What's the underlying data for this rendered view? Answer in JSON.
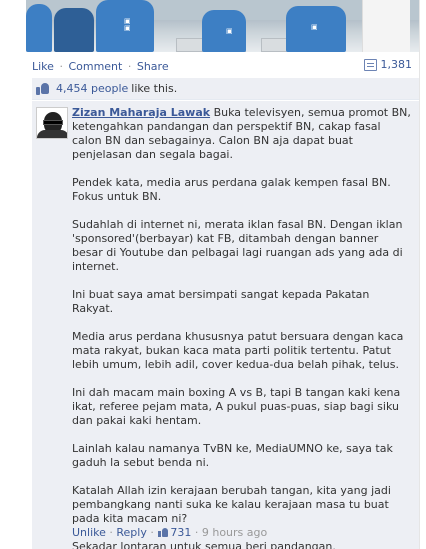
{
  "actions": {
    "like": "Like",
    "comment": "Comment",
    "share": "Share",
    "separator": "·",
    "share_count": "1,381"
  },
  "likes": {
    "count_text": "4,454 people",
    "suffix": "like this."
  },
  "comment": {
    "author": "Zizan Maharaja Lawak",
    "paragraphs": [
      "Buka televisyen, semua promot BN, ketengahkan pandangan dan perspektif BN, cakap fasal calon BN dan sebagainya. Calon BN aja dapat buat penjelasan dan segala bagai.",
      "Pendek kata, media arus perdana galak kempen fasal BN. Fokus untuk BN.",
      "Sudahlah di internet ni, merata iklan fasal BN. Dengan iklan 'sponsored'(berbayar) kat FB, ditambah dengan banner besar di Youtube dan pelbagai lagi ruangan ads yang ada di internet.",
      "Ini buat saya amat bersimpati sangat kepada Pakatan Rakyat.",
      "Media arus perdana khususnya patut bersuara dengan kaca mata rakyat, bukan kaca mata parti politik tertentu. Patut lebih umum, lebih adil, cover kedua-dua belah pihak, telus.",
      "Ini dah macam main boxing A vs B, tapi B tangan kaki kena ikat, referee pejam mata, A pukul puas-puas, siap bagi siku dan pakai kaki hentam.",
      "Lainlah kalau namanya TvBN ke, MediaUMNO ke, saya tak gaduh la sebut benda ni.",
      "Katalah Allah izin kerajaan berubah tangan, kita yang jadi pembangkang nanti suka ke kalau kerajaan masa tu buat pada kita macam ni?",
      "Sekadar lontaran untuk semua beri pandangan."
    ],
    "footer": {
      "unlike": "Unlike",
      "reply": "Reply",
      "like_count": "731",
      "time": "9 hours ago",
      "separator": "·"
    }
  },
  "colors": {
    "link": "#3b5998",
    "panel": "#edeff4"
  }
}
